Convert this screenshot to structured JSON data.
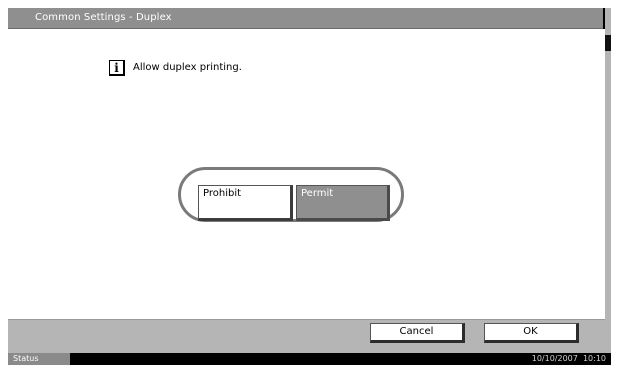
{
  "window": {
    "title": "Common Settings - Duplex"
  },
  "message": {
    "icon": "info-icon",
    "icon_glyph": "i",
    "text": "Allow duplex printing."
  },
  "duplex_setting": {
    "options": [
      "Prohibit",
      "Permit"
    ],
    "selected": "Permit"
  },
  "footer": {
    "cancel_label": "Cancel",
    "ok_label": "OK"
  },
  "status_bar": {
    "status_label": "Status",
    "date": "10/10/2007",
    "time": "10:10"
  },
  "colors": {
    "title_bar": "#8f8f8f",
    "selected_button": "#8f8f8f",
    "panel_gray": "#b5b5b5",
    "frame": "#000000"
  }
}
